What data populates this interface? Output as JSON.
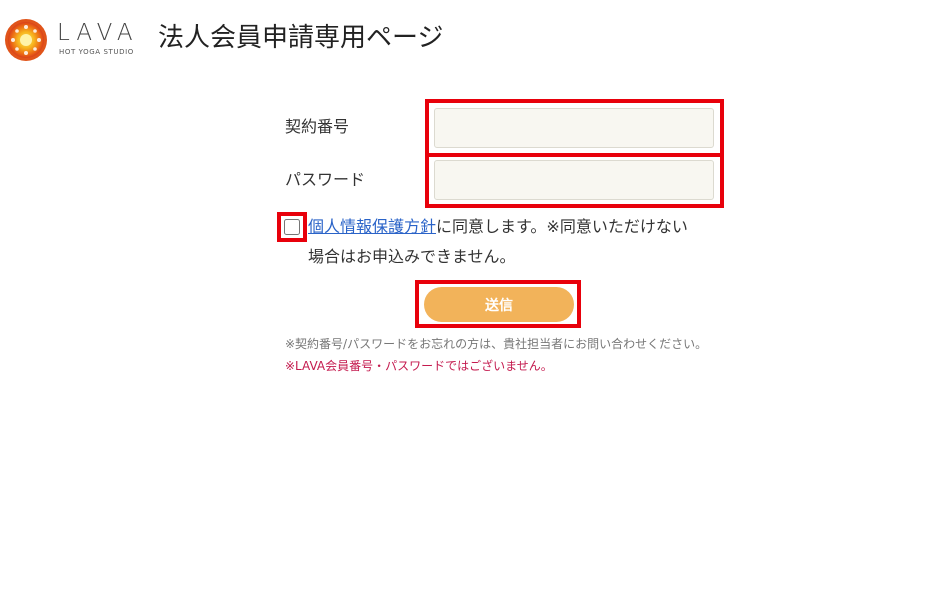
{
  "header": {
    "brand_name": "LAVA",
    "brand_sub": "HOT YOGA STUDIO",
    "page_title": "法人会員申請専用ページ"
  },
  "form": {
    "contract_number": {
      "label": "契約番号",
      "value": "",
      "placeholder": ""
    },
    "password": {
      "label": "パスワード",
      "value": "",
      "placeholder": ""
    },
    "consent": {
      "checked": false,
      "link_text": "個人情報保護方針",
      "text_line1": "に同意します。※同意いただけない",
      "text_line2": "場合はお申込みできません。"
    },
    "submit_label": "送信"
  },
  "notes": {
    "forgot": "※契約番号/パスワードをお忘れの方は、貴社担当者にお問い合わせください。",
    "warning": "※LAVA会員番号・パスワードではございません。"
  },
  "colors": {
    "highlight": "#e8000b",
    "button": "#f2b35a",
    "link": "#2a63c8",
    "warning": "#c41a4e",
    "field_bg": "#f8f7f1"
  },
  "icons": {
    "logo": "sun-logo-icon"
  }
}
